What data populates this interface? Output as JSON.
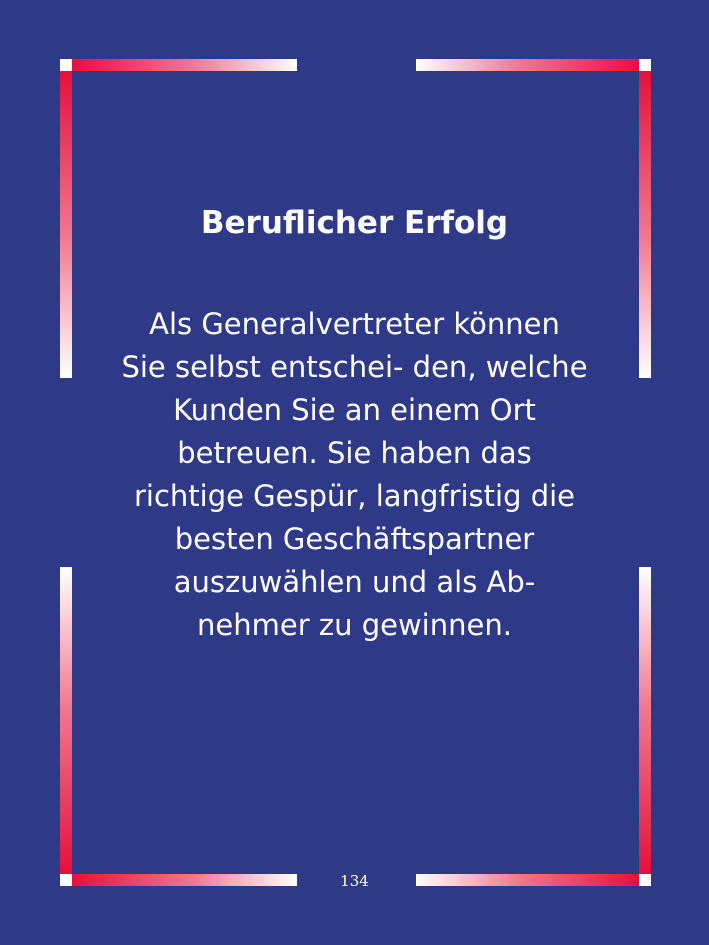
{
  "title": "Beruflicher Erfolg",
  "body": " Als Generalvertreter können\nSie selbst entschei- den, welche\nKunden Sie an einem Ort\nbetreuen. Sie haben das\nrichtige Gespür, langfristig die\nbesten Geschäftspartner\nauszuwählen und als Ab-\nnehmer zu gewinnen.",
  "page_number": "134",
  "colors": {
    "background": "#2e3a87",
    "frame_accent": "#e3103c",
    "frame_light": "#ffffff",
    "text": "#ffffff"
  }
}
